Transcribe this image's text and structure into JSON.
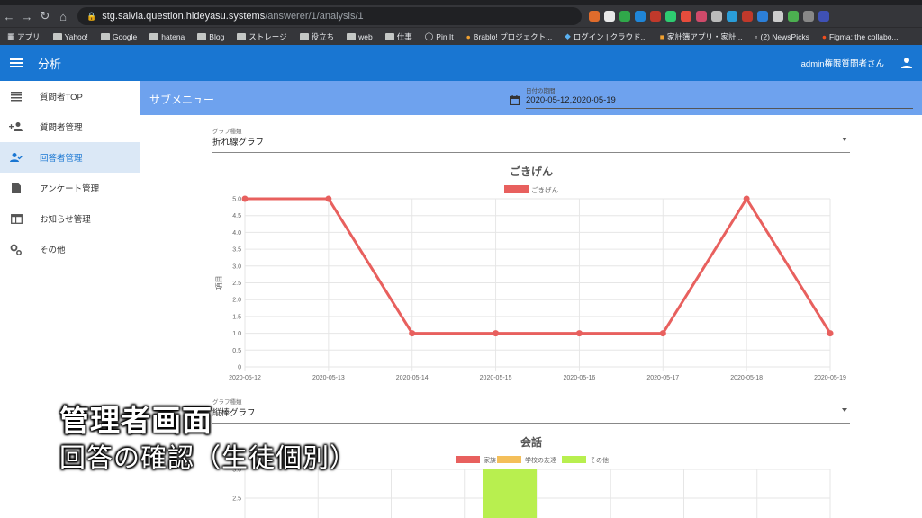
{
  "browser": {
    "url_host": "stg.salvia.question.hideyasu.systems",
    "url_path": "/answerer/1/analysis/1",
    "bookmarks": [
      "アプリ",
      "Yahoo!",
      "Google",
      "hatena",
      "Blog",
      "ストレージ",
      "役立ち",
      "web",
      "仕事",
      "Pin It",
      "Brablo! プロジェクト...",
      "ログイン | クラウド...",
      "家計簿アプリ・家計...",
      "(2) NewsPicks",
      "Figma: the collabo..."
    ]
  },
  "appbar": {
    "title": "分析",
    "user": "admin権限質問者さん"
  },
  "sidebar": {
    "items": [
      {
        "label": "質問者TOP",
        "icon": "list-icon"
      },
      {
        "label": "質問者管理",
        "icon": "person-add-icon"
      },
      {
        "label": "回答者管理",
        "icon": "person-check-icon",
        "active": true
      },
      {
        "label": "アンケート管理",
        "icon": "document-icon"
      },
      {
        "label": "お知らせ管理",
        "icon": "web-icon"
      },
      {
        "label": "その他",
        "icon": "gears-icon"
      }
    ]
  },
  "submenu": {
    "title": "サブメニュー",
    "date_label": "日付の期間",
    "date_value": "2020-05-12,2020-05-19"
  },
  "select1": {
    "label": "グラフ種類",
    "value": "折れ線グラフ"
  },
  "select2": {
    "label": "グラフ種類",
    "value": "縦棒グラフ"
  },
  "chart_data": [
    {
      "type": "line",
      "title": "ごきげん",
      "ylabel": "項目",
      "categories": [
        "2020-05-12",
        "2020-05-13",
        "2020-05-14",
        "2020-05-15",
        "2020-05-16",
        "2020-05-17",
        "2020-05-18",
        "2020-05-19"
      ],
      "series": [
        {
          "name": "ごきげん",
          "values": [
            5.0,
            5.0,
            1.0,
            1.0,
            1.0,
            1.0,
            5.0,
            1.0
          ],
          "color": "#e8605e"
        }
      ],
      "yticks": [
        "0",
        "0.5",
        "1.0",
        "1.5",
        "2.0",
        "2.5",
        "3.0",
        "3.5",
        "4.0",
        "4.5",
        "5.0"
      ],
      "ylim": [
        0,
        5
      ],
      "grid": true,
      "legend": "top"
    },
    {
      "type": "bar",
      "title": "会話",
      "series": [
        {
          "name": "家族",
          "color": "#e8605e"
        },
        {
          "name": "学校の友達",
          "color": "#f4bf5a"
        },
        {
          "name": "その他",
          "color": "#b8ef4f"
        }
      ],
      "yticks_visible": [
        "3.0",
        "2.5"
      ],
      "grid": true,
      "legend": "top"
    }
  ],
  "overlay": {
    "title": "管理者画面",
    "subtitle": "回答の確認（生徒個別）"
  }
}
